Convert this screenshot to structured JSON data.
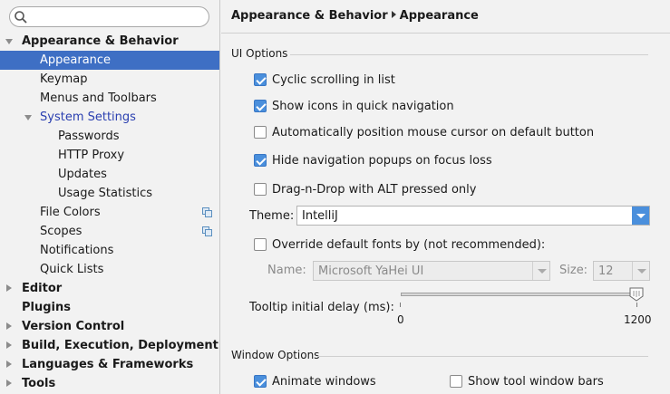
{
  "sidebar": {
    "search_placeholder": "",
    "items": [
      {
        "label": "Appearance & Behavior",
        "level": 0,
        "expanded": true,
        "bold": true
      },
      {
        "label": "Appearance",
        "level": 1,
        "selected": true
      },
      {
        "label": "Keymap",
        "level": 1
      },
      {
        "label": "Menus and Toolbars",
        "level": 1
      },
      {
        "label": "System Settings",
        "level": 1,
        "expanded": true
      },
      {
        "label": "Passwords",
        "level": 2
      },
      {
        "label": "HTTP Proxy",
        "level": 2
      },
      {
        "label": "Updates",
        "level": 2
      },
      {
        "label": "Usage Statistics",
        "level": 2
      },
      {
        "label": "File Colors",
        "level": 1,
        "icon": "copy-icon"
      },
      {
        "label": "Scopes",
        "level": 1,
        "icon": "copy-icon"
      },
      {
        "label": "Notifications",
        "level": 1
      },
      {
        "label": "Quick Lists",
        "level": 1
      },
      {
        "label": "Editor",
        "level": 0,
        "bold": true
      },
      {
        "label": "Plugins",
        "level": 0,
        "bold": true
      },
      {
        "label": "Version Control",
        "level": 0,
        "bold": true
      },
      {
        "label": "Build, Execution, Deployment",
        "level": 0,
        "bold": true
      },
      {
        "label": "Languages & Frameworks",
        "level": 0,
        "bold": true
      },
      {
        "label": "Tools",
        "level": 0,
        "bold": true
      }
    ]
  },
  "breadcrumb": {
    "parent": "Appearance & Behavior",
    "current": "Appearance"
  },
  "ui_options": {
    "title": "UI Options",
    "cyclic_scrolling": {
      "label": "Cyclic scrolling in list",
      "checked": true
    },
    "show_icons": {
      "label": "Show icons in quick navigation",
      "checked": true
    },
    "auto_cursor": {
      "label": "Automatically position mouse cursor on default button",
      "checked": false
    },
    "hide_popups": {
      "label": "Hide navigation popups on focus loss",
      "checked": true
    },
    "drag_drop": {
      "label": "Drag-n-Drop with ALT pressed only",
      "checked": false
    },
    "theme": {
      "label": "Theme:",
      "value": "IntelliJ"
    },
    "override_fonts": {
      "label": "Override default fonts by (not recommended):",
      "checked": false
    },
    "font_name": {
      "label": "Name:",
      "value": "Microsoft YaHei UI"
    },
    "font_size": {
      "label": "Size:",
      "value": "12"
    },
    "tooltip_delay": {
      "label": "Tooltip initial delay (ms):",
      "min": "0",
      "max": "1200",
      "value": 1200
    }
  },
  "window_options": {
    "title": "Window Options",
    "animate_windows": {
      "label": "Animate windows",
      "checked": true
    },
    "show_tool_bars": {
      "label": "Show tool window bars",
      "checked": false
    }
  },
  "colors": {
    "accent": "#4a8fdc",
    "selection": "#3e6fc4",
    "system_settings": "#2a3fb0"
  }
}
